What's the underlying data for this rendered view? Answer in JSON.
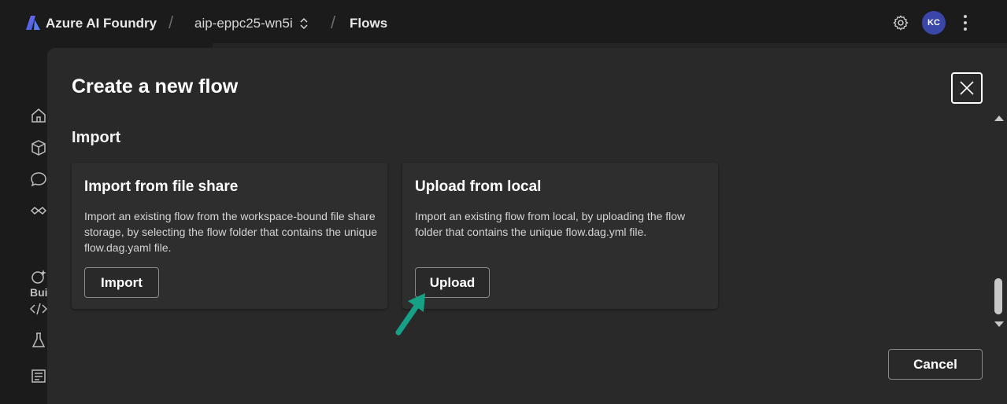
{
  "header": {
    "app_name": "Azure AI Foundry",
    "separator": "/",
    "project_name": "aip-eppc25-wn5i",
    "breadcrumb_current": "Flows",
    "avatar_initials": "KC"
  },
  "sidebar": {
    "section_label": "Bui",
    "icons": [
      "home-icon",
      "cube-icon",
      "chat-icon",
      "infinity-icon",
      "sparkle-icon",
      "code-icon",
      "flask-icon",
      "list-icon"
    ]
  },
  "modal": {
    "title": "Create a new flow",
    "section_title": "Import",
    "cards": [
      {
        "title": "Import from file share",
        "description": "Import an existing flow from the workspace-bound file share storage, by selecting the flow folder that contains the unique flow.dag.yaml file.",
        "button_label": "Import"
      },
      {
        "title": "Upload from local",
        "description": "Import an existing flow from local, by uploading the flow folder that contains the unique flow.dag.yml file.",
        "button_label": "Upload"
      }
    ],
    "cancel_label": "Cancel"
  },
  "colors": {
    "background": "#1b1b1b",
    "modal": "#292929",
    "card": "#2e2e2e",
    "avatar": "#3a46a8",
    "annotation_arrow": "#16a085"
  }
}
